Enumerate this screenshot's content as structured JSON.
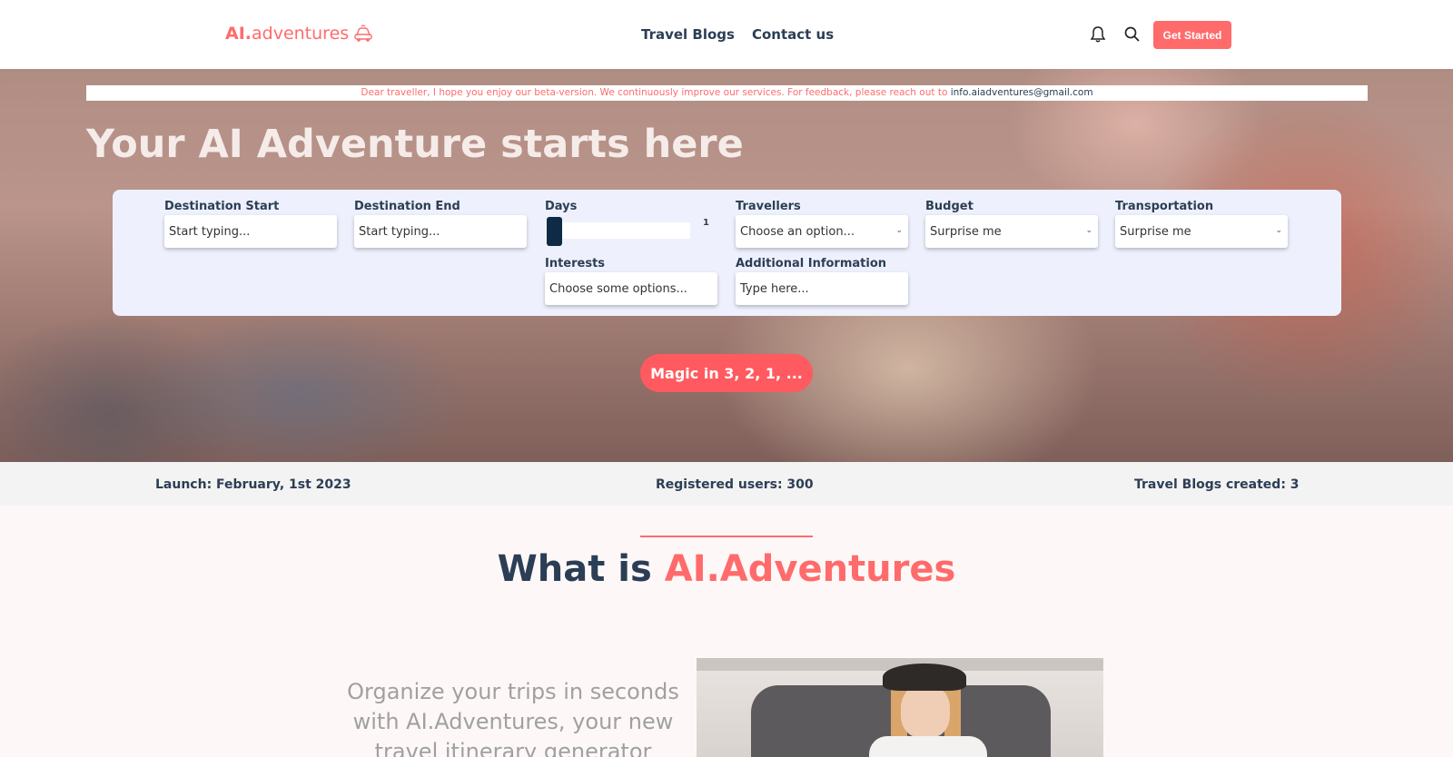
{
  "header": {
    "logo_ai": "AI.",
    "logo_rest": "adventures",
    "nav": [
      "Travel Blogs",
      "Contact us"
    ],
    "get_started": "Get Started",
    "brand_color": "#ff6b6b"
  },
  "hero": {
    "notice_message": "Dear traveller, I hope you enjoy our beta-version. We continuously improve our services. For feedback, please reach out to",
    "notice_email": "info.aiadventures@gmail.com",
    "title": "Your AI Adventure starts here",
    "form": {
      "destination_start": {
        "label": "Destination Start",
        "placeholder": "Start typing..."
      },
      "destination_end": {
        "label": "Destination End",
        "placeholder": "Start typing..."
      },
      "days": {
        "label": "Days",
        "value": "1"
      },
      "travellers": {
        "label": "Travellers",
        "value": "Choose an option..."
      },
      "budget": {
        "label": "Budget",
        "value": "Surprise me"
      },
      "transportation": {
        "label": "Transportation",
        "value": "Surprise me"
      },
      "interests": {
        "label": "Interests",
        "value": "Choose some options..."
      },
      "additional_info": {
        "label": "Additional Information",
        "placeholder": "Type here..."
      }
    },
    "magic_button": "Magic in 3, 2, 1, ..."
  },
  "stats": {
    "launch": "Launch: February, 1st 2023",
    "users": "Registered users: 300",
    "blogs": "Travel Blogs created: 3"
  },
  "what_is": {
    "title_dark": "What is",
    "title_accent": "AI.Adventures",
    "description": "Organize your trips in seconds with AI.Adventures, your new travel itinerary generator"
  }
}
